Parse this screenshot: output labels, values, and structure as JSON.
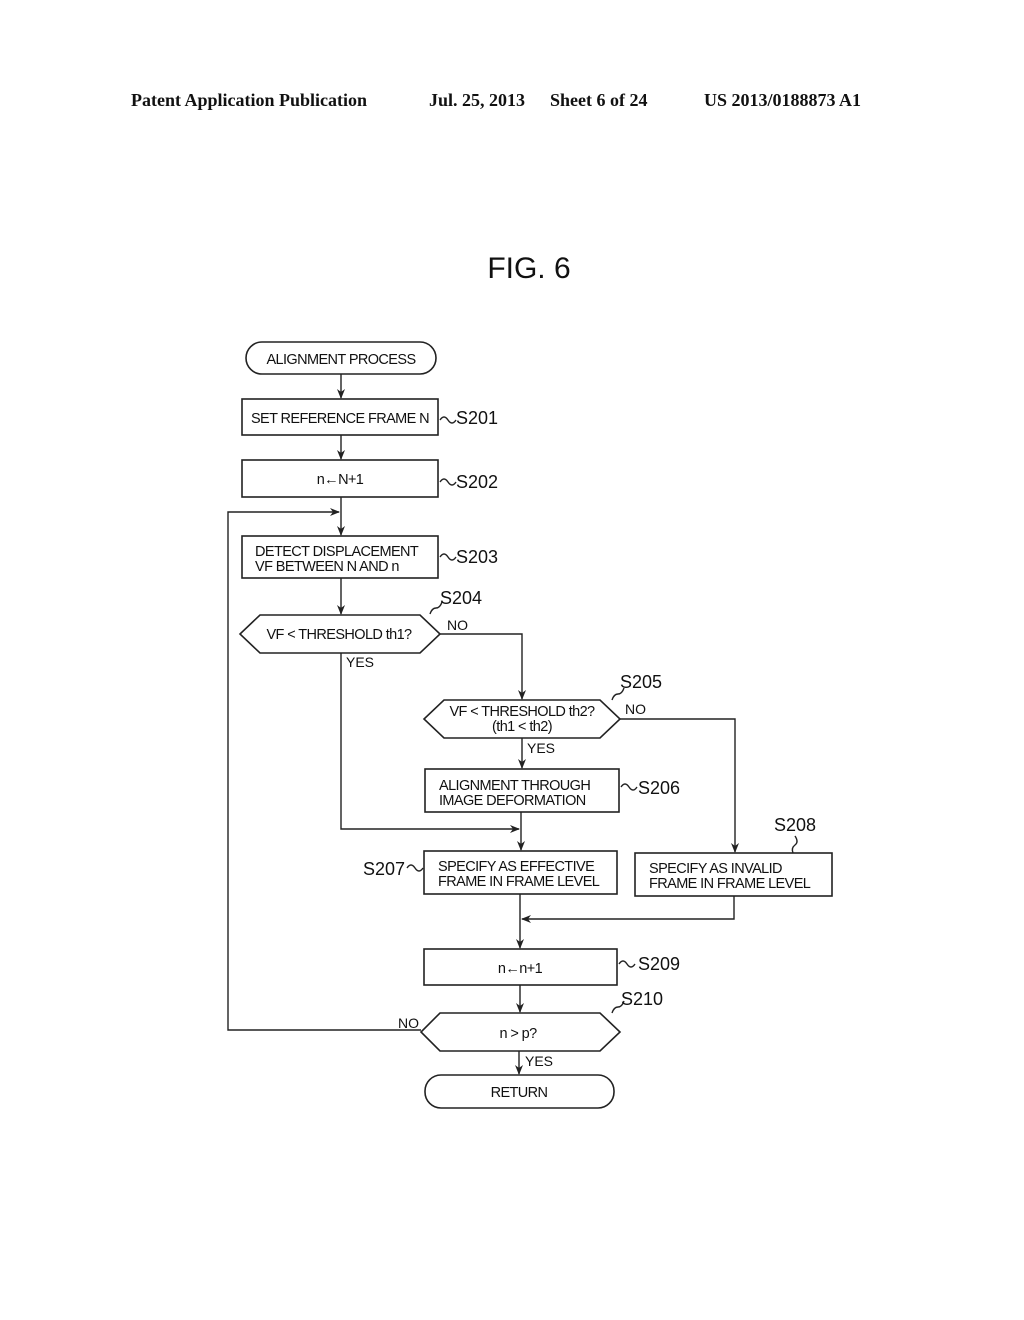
{
  "header": {
    "publication": "Patent Application Publication",
    "date": "Jul. 25, 2013",
    "sheet": "Sheet 6 of 24",
    "number": "US 2013/0188873 A1"
  },
  "figure": {
    "title": "FIG. 6"
  },
  "flowchart": {
    "start": "ALIGNMENT PROCESS",
    "end": "RETURN",
    "steps": {
      "s201": {
        "label": "S201",
        "text": "SET REFERENCE FRAME N"
      },
      "s202": {
        "label": "S202",
        "text": "n←N+1"
      },
      "s203": {
        "label": "S203",
        "line1": "DETECT DISPLACEMENT",
        "line2": "VF BETWEEN N AND n"
      },
      "s204": {
        "label": "S204",
        "text": "VF < THRESHOLD th1?",
        "no": "NO",
        "yes": "YES"
      },
      "s205": {
        "label": "S205",
        "line1": "VF < THRESHOLD th2?",
        "line2": "(th1 < th2)",
        "no": "NO",
        "yes": "YES"
      },
      "s206": {
        "label": "S206",
        "line1": "ALIGNMENT THROUGH",
        "line2": "IMAGE DEFORMATION"
      },
      "s207": {
        "label": "S207",
        "line1": "SPECIFY AS EFFECTIVE",
        "line2": "FRAME IN FRAME LEVEL"
      },
      "s208": {
        "label": "S208",
        "line1": "SPECIFY AS INVALID",
        "line2": "FRAME IN FRAME LEVEL"
      },
      "s209": {
        "label": "S209",
        "text": "n←n+1"
      },
      "s210": {
        "label": "S210",
        "text": "n > p?",
        "no": "NO",
        "yes": "YES"
      }
    }
  }
}
